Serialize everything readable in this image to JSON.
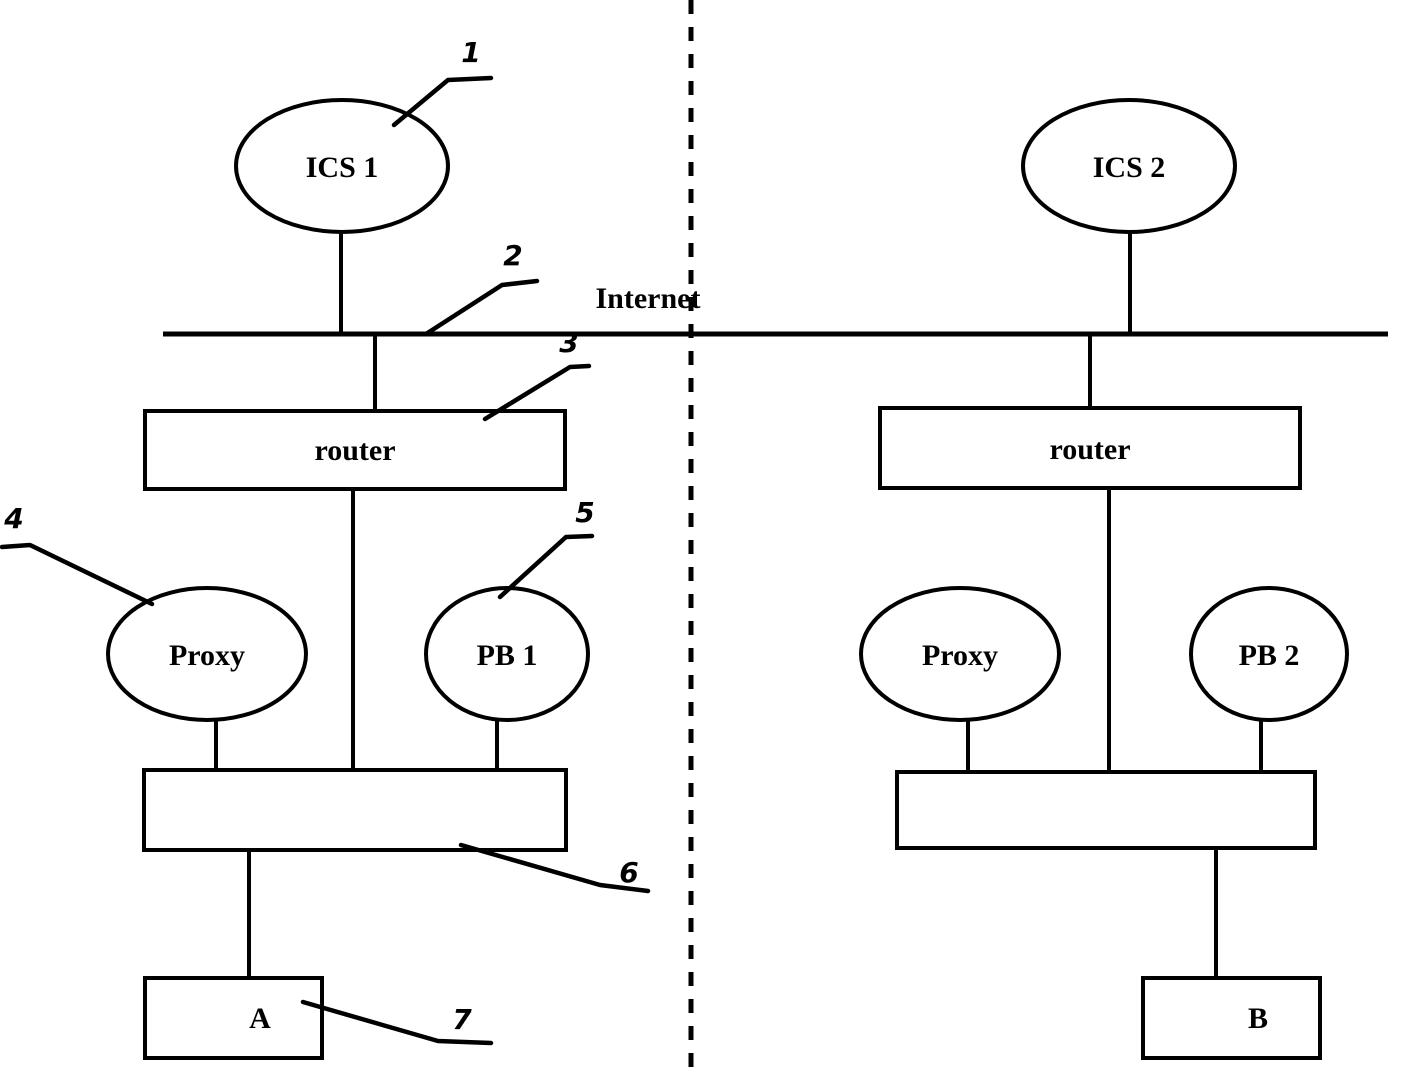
{
  "diagram": {
    "title": "Internet network topology with ICS, router, proxy, PB and hosts",
    "network_label": "Internet",
    "colors": {
      "background": "#ffffff",
      "stroke": "#000000"
    },
    "left_site": {
      "ics_label": "ICS 1",
      "router_label": "router",
      "proxy_label": "Proxy",
      "pb_label": "PB 1",
      "lan_label": "",
      "host_label": "A"
    },
    "right_site": {
      "ics_label": "ICS 2",
      "router_label": "router",
      "proxy_label": "Proxy",
      "pb_label": "PB 2",
      "lan_label": "",
      "host_label": "B"
    },
    "callouts": [
      {
        "id": "callout-1",
        "text": "1"
      },
      {
        "id": "callout-2",
        "text": "2"
      },
      {
        "id": "callout-3",
        "text": "3"
      },
      {
        "id": "callout-4",
        "text": "4"
      },
      {
        "id": "callout-5",
        "text": "5"
      },
      {
        "id": "callout-6",
        "text": "6"
      },
      {
        "id": "callout-7",
        "text": "7"
      }
    ]
  }
}
